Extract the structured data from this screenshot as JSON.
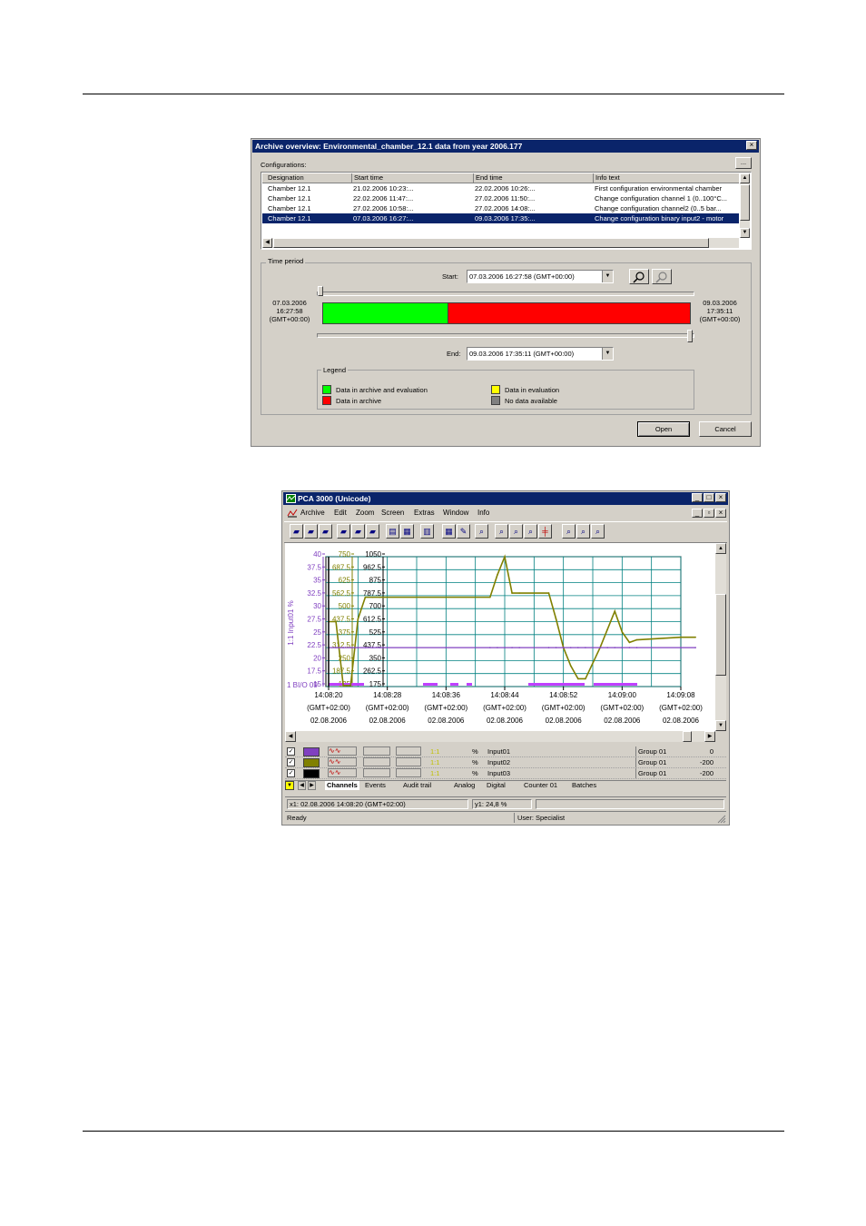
{
  "dialog": {
    "title": "Archive overview: Environmental_chamber_12.1 data from year 2006.177",
    "close_glyph": "×",
    "configurations_label": "Configurations:",
    "more_button": "...",
    "columns": [
      "Designation",
      "Start time",
      "End time",
      "Info text"
    ],
    "rows": [
      [
        "Chamber 12.1",
        "21.02.2006 10:23:...",
        "22.02.2006 10:26:...",
        "First configuration environmental chamber"
      ],
      [
        "Chamber 12.1",
        "22.02.2006 11:47:...",
        "27.02.2006 11:50:...",
        "Change configuration channel 1 (0..100°C..."
      ],
      [
        "Chamber 12.1",
        "27.02.2006 10:58:...",
        "27.02.2006 14:08:...",
        "Change configuration channel2 (0..5 bar..."
      ],
      [
        "Chamber 12.1",
        "07.03.2006 16:27:...",
        "09.03.2006 17:35:...",
        "Change configuration binary input2 - motor"
      ]
    ],
    "selected_row": 3,
    "time_period_label": "Time period",
    "start_label": "Start:",
    "start_value": "07.03.2006 16:27:58   (GMT+00:00)",
    "end_label": "End:",
    "end_value": "09.03.2006 17:35:11   (GMT+00:00)",
    "left_date": [
      "07.03.2006",
      "16:27:58",
      "(GMT+00:00)"
    ],
    "right_date": [
      "09.03.2006",
      "17:35:11",
      "(GMT+00:00)"
    ],
    "bar_green_fraction": 0.34,
    "legend_label": "Legend",
    "legend": [
      {
        "color": "#00ff00",
        "label": "Data in archive and evaluation"
      },
      {
        "color": "#ff0000",
        "label": "Data in archive"
      },
      {
        "color": "#ffff00",
        "label": "Data in evaluation"
      },
      {
        "color": "#808080",
        "label": "No data available"
      }
    ],
    "open_button": "Open",
    "cancel_button": "Cancel"
  },
  "app": {
    "title": "PCA 3000 (Unicode)",
    "menu": [
      "Archive",
      "Edit",
      "Zoom",
      "Screen",
      "Extras",
      "Window",
      "Info"
    ],
    "axis_y1": [
      "40",
      "37.5",
      "35",
      "32.5",
      "30",
      "27.5",
      "25",
      "22.5",
      "20",
      "17.5",
      "15"
    ],
    "axis_y2": [
      "750",
      "687.5",
      "625",
      "562.5",
      "500",
      "437.5",
      "375",
      "312.5",
      "250",
      "187.5",
      "125"
    ],
    "axis_y3": [
      "1050",
      "962.5",
      "875",
      "787.5",
      "700",
      "612.5",
      "525",
      "437.5",
      "350",
      "262.5",
      "175"
    ],
    "axis_title": "1:1 Input01 %",
    "binary_label": "1 BI/O 09",
    "x_times": [
      "14:08:20",
      "14:08:28",
      "14:08:36",
      "14:08:44",
      "14:08:52",
      "14:09:00",
      "14:09:08"
    ],
    "x_tz": "(GMT+02:00)",
    "x_date": "02.08.2006",
    "channels": [
      {
        "scale": "1:1",
        "unit": "%",
        "name": "Input01",
        "group": "Group 01",
        "value": "0",
        "color": "#8040c0"
      },
      {
        "scale": "1:1",
        "unit": "%",
        "name": "Input02",
        "group": "Group 01",
        "value": "-200",
        "color": "#808000"
      },
      {
        "scale": "1:1",
        "unit": "%",
        "name": "Input03",
        "group": "Group 01",
        "value": "-200",
        "color": "#000000"
      }
    ],
    "tabs": [
      "Channels",
      "Events",
      "Audit trail",
      "Analog",
      "Digital",
      "Counter 01",
      "Batches"
    ],
    "cursor_x": "x1: 02.08.2006 14:08:20 (GMT+02:00)",
    "cursor_y": "y1: 24,8 %",
    "status_ready": "Ready",
    "status_user": "User: Specialist"
  },
  "chart_data": {
    "type": "line",
    "title": "",
    "xlabel": "",
    "ylabel": "1:1 Input01 %",
    "ylim": [
      15,
      40
    ],
    "x": [
      "14:08:20",
      "14:08:21",
      "14:08:22",
      "14:08:23",
      "14:08:24",
      "14:08:25",
      "14:08:26",
      "14:08:27",
      "14:08:36",
      "14:08:42",
      "14:08:43",
      "14:08:44",
      "14:08:45",
      "14:08:46",
      "14:08:50",
      "14:08:51",
      "14:08:52",
      "14:08:53",
      "14:08:54",
      "14:08:55",
      "14:08:57",
      "14:08:58",
      "14:08:59",
      "14:09:00",
      "14:09:01",
      "14:09:02",
      "14:09:08",
      "14:09:10"
    ],
    "series": [
      {
        "values": [
          27.5,
          27.5,
          15.2,
          15.2,
          28,
          32.2,
          32.2,
          32.2,
          32.2,
          32.2,
          36.5,
          40,
          33,
          33,
          33,
          28,
          22.5,
          19,
          16.5,
          16.5,
          22.5,
          26,
          29.5,
          25.5,
          23.5,
          24,
          24.5,
          24.5
        ]
      },
      {
        "values": [
          22.5,
          22.5,
          22.5,
          22.5,
          22.5,
          22.5,
          22.5,
          22.5,
          22.5,
          22.5,
          22.5,
          22.5,
          22.5,
          22.5,
          22.5,
          22.5,
          22.5,
          22.5,
          22.5,
          22.5,
          22.5,
          22.5,
          22.5,
          22.5,
          22.5,
          22.5,
          22.5,
          22.5
        ]
      }
    ]
  }
}
